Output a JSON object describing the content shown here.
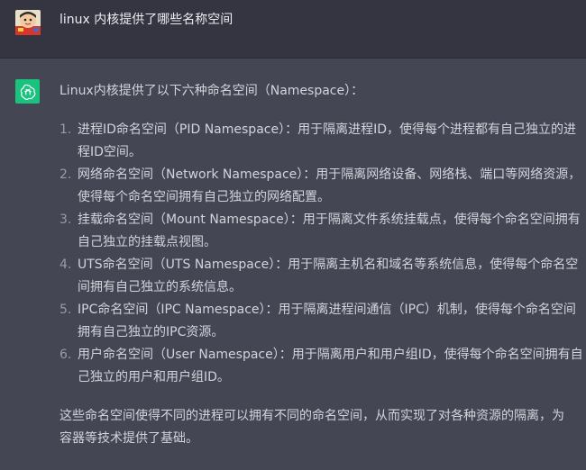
{
  "user_message": {
    "avatar_icon": "user-avatar-icon",
    "text": "linux 内核提供了哪些名称空间"
  },
  "assistant_message": {
    "avatar_icon": "openai-logo-icon",
    "avatar_color": "#19c37d",
    "intro": "Linux内核提供了以下六种命名空间（Namespace）：",
    "items": [
      {
        "number": "1.",
        "text": "进程ID命名空间（PID Namespace）：用于隔离进程ID，使得每个进程都有自己独立的进程ID空间。"
      },
      {
        "number": "2.",
        "text": "网络命名空间（Network Namespace）：用于隔离网络设备、网络栈、端口等网络资源，使得每个命名空间拥有自己独立的网络配置。"
      },
      {
        "number": "3.",
        "text": "挂载命名空间（Mount Namespace）：用于隔离文件系统挂载点，使得每个命名空间拥有自己独立的挂载点视图。"
      },
      {
        "number": "4.",
        "text": "UTS命名空间（UTS Namespace）：用于隔离主机名和域名等系统信息，使得每个命名空间拥有自己独立的系统信息。"
      },
      {
        "number": "5.",
        "text": "IPC命名空间（IPC Namespace）：用于隔离进程间通信（IPC）机制，使得每个命名空间拥有自己独立的IPC资源。"
      },
      {
        "number": "6.",
        "text": "用户命名空间（User Namespace）：用于隔离用户和用户组ID，使得每个命名空间拥有自己独立的用户和用户组ID。"
      }
    ],
    "conclusion": "这些命名空间使得不同的进程可以拥有不同的命名空间，从而实现了对各种资源的隔离，为容器等技术提供了基础。"
  },
  "colors": {
    "user_row_bg": "#343541",
    "assistant_row_bg": "#444654",
    "text": "#d1d5db"
  }
}
